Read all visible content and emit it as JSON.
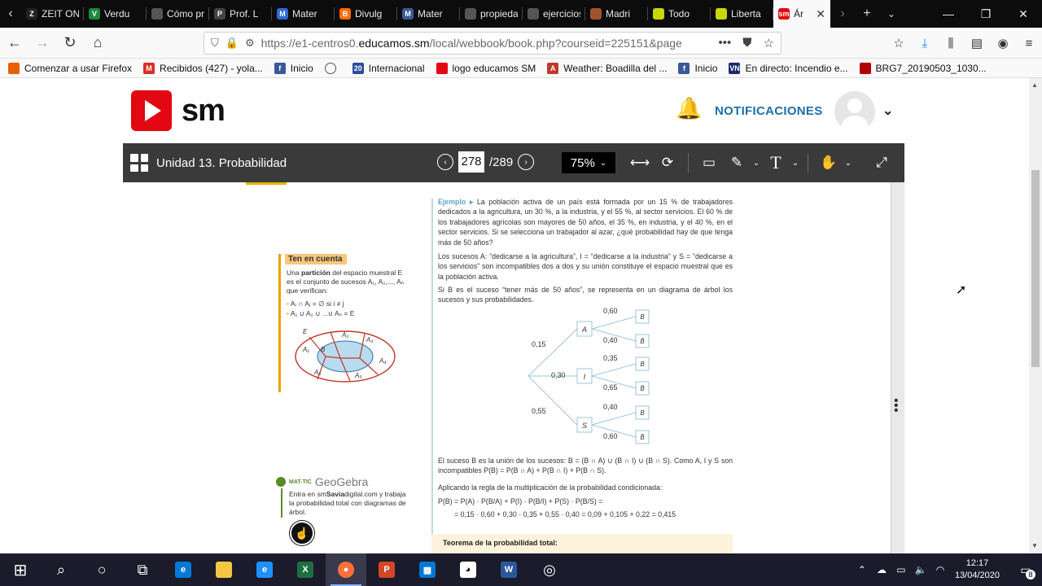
{
  "browser": {
    "tabs": [
      {
        "label": "ZEIT ONLI",
        "color": "#222222",
        "glyph": "Z"
      },
      {
        "label": "Verdu",
        "color": "#1a8a3a",
        "glyph": "V"
      },
      {
        "label": "Cómo pre",
        "color": "#555555",
        "glyph": ""
      },
      {
        "label": "Prof. L",
        "color": "#444444",
        "glyph": "P"
      },
      {
        "label": "Mater",
        "color": "#2b6cd4",
        "glyph": "M"
      },
      {
        "label": "Divulg",
        "color": "#ff6d00",
        "glyph": "B"
      },
      {
        "label": "Mater",
        "color": "#3b5998",
        "glyph": "M"
      },
      {
        "label": "propiedad",
        "color": "#555555",
        "glyph": ""
      },
      {
        "label": "ejercicios",
        "color": "#555555",
        "glyph": ""
      },
      {
        "label": "Madri",
        "color": "#a0522d",
        "glyph": ""
      },
      {
        "label": "Todo",
        "color": "#c8d800",
        "glyph": ""
      },
      {
        "label": "Liberta",
        "color": "#c8d800",
        "glyph": ""
      },
      {
        "label": "Ár",
        "color": "#e30613",
        "glyph": "sm",
        "active": true
      }
    ],
    "url_prefix": "https://e1-centros0.",
    "url_domain": "educamos.sm",
    "url_path": "/local/webbook/book.php?courseid=225151&page",
    "bookmarks": [
      {
        "label": "Comenzar a usar Firefox",
        "color": "#e66000",
        "glyph": ""
      },
      {
        "label": "Recibidos (427) - yola...",
        "color": "#d93025",
        "glyph": "M"
      },
      {
        "label": "Inicio",
        "color": "#3b5998",
        "glyph": "f"
      },
      {
        "label": "",
        "color": "#555555",
        "glyph": ""
      },
      {
        "label": "Internacional",
        "color": "#2a4b9b",
        "glyph": "20"
      },
      {
        "label": "logo educamos SM",
        "color": "#e30613",
        "glyph": ""
      },
      {
        "label": "Weather: Boadilla del ...",
        "color": "#c0392b",
        "glyph": "A"
      },
      {
        "label": "Inicio",
        "color": "#3b5998",
        "glyph": "f"
      },
      {
        "label": "En directo: Incendio e...",
        "color": "#1a2a6c",
        "glyph": "VN"
      },
      {
        "label": "BRG7_20190503_1030...",
        "color": "#b00000",
        "glyph": ""
      }
    ]
  },
  "header": {
    "logo_text": "sm",
    "notifications_label": "NOTIFICACIONES"
  },
  "viewer": {
    "title": "Unidad 13. Probabilidad",
    "page_current": "278",
    "page_total": "/289",
    "zoom": "75%"
  },
  "book": {
    "ten_cuenta_title": "Ten en cuenta",
    "ten_cuenta_intro_1": "Una ",
    "ten_cuenta_partition": "partición",
    "ten_cuenta_intro_2": " del espacio muestral E es el conjunto de sucesos A₁, A₂,..., Aₙ que verifican:",
    "ten_cuenta_rule_1": "Aᵢ ∩ Aⱼ = ∅ si i ≠ j",
    "ten_cuenta_rule_2": "A₁ ∪ A₂ ∪ ...∪ Aₙ = E",
    "geo_tag": "MAT-TIC",
    "geo_brand": "GeoGebra",
    "geo_text_1": "Entra en sm",
    "geo_text_brand": "Savia",
    "geo_text_2": "digital.com y trabaja la probabilidad total con diagramas de árbol.",
    "ej_label": "Ejemplo ▸",
    "ej_p1": "La población activa de un país está formada por un 15 % de trabajadores dedicados a la agricultura, un 30 %, a la industria, y el 55 %, al sector servicios. El 60 % de los trabajadores agrícolas son mayores de 50 años, el 35 %, en industria, y el 40 %, en el sector servicios. Si se selecciona un trabajador al azar, ¿qué probabilidad hay de que tenga más de 50 años?",
    "ej_p2": "Los sucesos A: “dedicarse a la agricultura”, I = “dedicarse a la industria” y S = “dedicarse a los servicios” son incompatibles dos a dos y su unión constituye el espacio muestral que es la población activa.",
    "ej_p3": "Si B es el suceso “tener más de 50 años”, se representa en un diagrama de árbol los sucesos y sus probabilidades.",
    "ej_p4": "El suceso B es la unión de los sucesos: B = (B ∩ A) ∪ (B ∩ I) ∪ (B ∩ S). Como A, I y S son incompatibles P(B) = P(B ∩ A) + P(B ∩ I) + P(B ∩ S).",
    "ej_p5": "Aplicando la regla de la multiplicación de la probabilidad condicionada:",
    "ej_f1": "P(B) = P(A) · P(B/A) + P(I) · P(B/I) + P(S) · P(B/S) =",
    "ej_f2": "= 0,15 · 0,60 + 0,30 · 0,35 + 0,55 · 0,40 = 0,09 + 0,105 + 0,22 = 0,415",
    "teorema": "Teorema de la probabilidad total:",
    "tree": {
      "branches": [
        {
          "node": "A",
          "p": "0,15",
          "sub": [
            {
              "p": "0,60",
              "leaf": "B"
            },
            {
              "p": "0,40",
              "leaf": "B̄"
            }
          ]
        },
        {
          "node": "I",
          "p": "0,30",
          "sub": [
            {
              "p": "0,35",
              "leaf": "B"
            },
            {
              "p": "0,65",
              "leaf": "B̄"
            }
          ]
        },
        {
          "node": "S",
          "p": "0,55",
          "sub": [
            {
              "p": "0,40",
              "leaf": "B"
            },
            {
              "p": "0,60",
              "leaf": "B̄"
            }
          ]
        }
      ]
    },
    "venn_labels": {
      "e": "E",
      "a1": "A₁",
      "a2": "A₂",
      "a3": "A₃",
      "a4": "A₄",
      "a5": "A₅",
      "a6": "A₆",
      "b": "B"
    }
  },
  "taskbar": {
    "time": "12:17",
    "date": "13/04/2020",
    "notification_count": "8"
  }
}
